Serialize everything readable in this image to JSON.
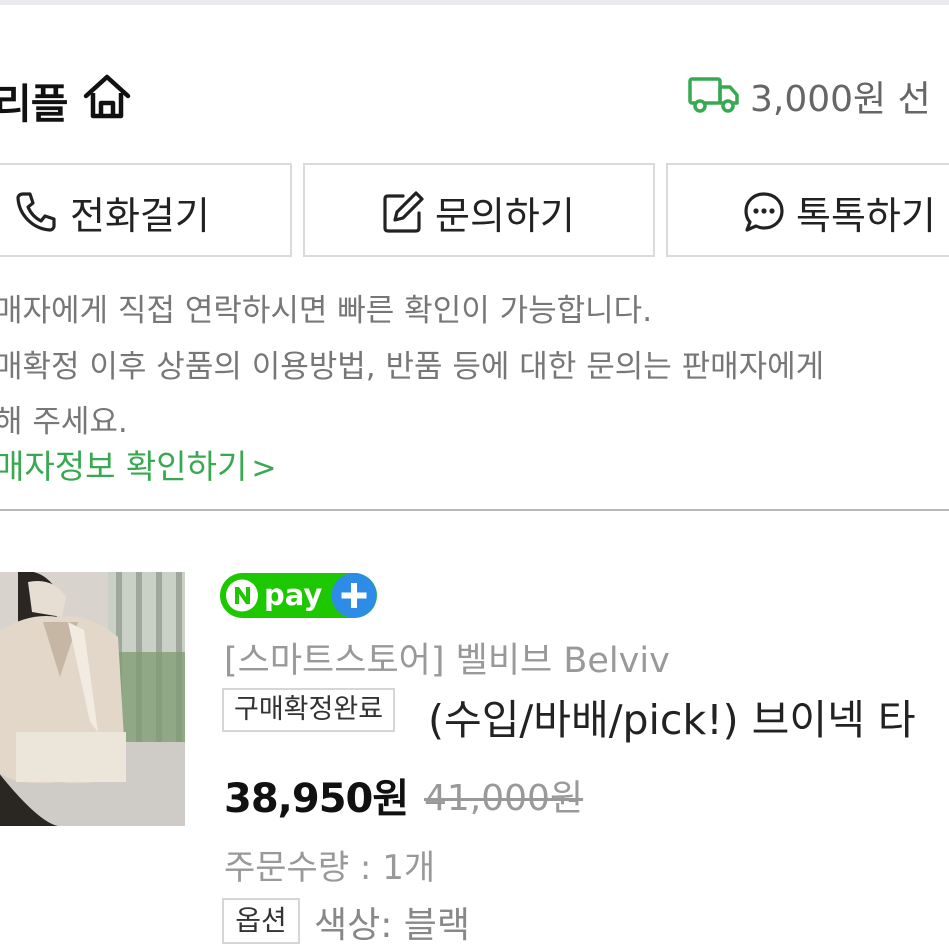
{
  "store": {
    "name": "리플",
    "shipping": "3,000원 선"
  },
  "actions": {
    "call": "전화걸기",
    "inquiry": "문의하기",
    "talk": "톡톡하기"
  },
  "notice": {
    "line1": "매자에게 직접 연락하시면 빠른 확인이 가능합니다.",
    "line2": "매확정 이후 상품의 이용방법, 반품 등에 대한 문의는 판매자에게",
    "line3": "해 주세요.",
    "seller_link": "매자정보 확인하기"
  },
  "order": {
    "pay_badge": "pay",
    "shop": "[스마트스토어] 벨비브 Belviv",
    "status": "구매확정완료",
    "title": "(수입/바배/pick!) 브이넥 타",
    "price": "38,950원",
    "original_price": "41,000원",
    "quantity": "주문수량 : 1개",
    "option_label": "옵션",
    "option_value": "색상: 블랙"
  },
  "colors": {
    "accent_green": "#39a951",
    "npay_green": "#1ec800",
    "npay_plus_blue": "#2c8ce6"
  }
}
